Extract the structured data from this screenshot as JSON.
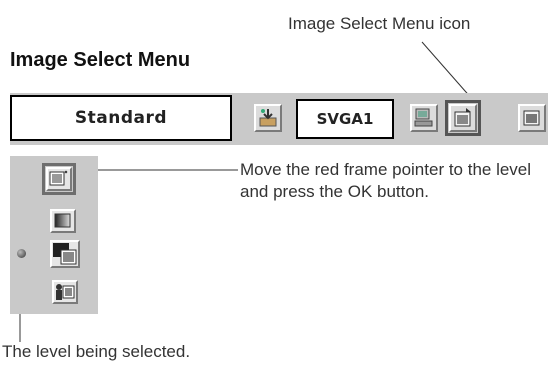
{
  "callouts": {
    "menu_icon_label": "Image Select Menu icon",
    "pointer_instruction": "Move the red frame pointer to the level and press the OK button.",
    "level_selected": "The level being selected."
  },
  "section": {
    "title": "Image Select Menu"
  },
  "menubar": {
    "mode_value": "Standard",
    "input_value": "SVGA1",
    "icons": [
      "input-source-icon",
      "pc-adjust-icon",
      "image-select-menu-icon",
      "image-adjust-icon"
    ]
  },
  "level_panel": {
    "icons": [
      "standard-level-icon",
      "natural-level-icon",
      "real-level-icon",
      "image-level-icon"
    ],
    "selected_index": 2,
    "pointer_index": 0
  }
}
